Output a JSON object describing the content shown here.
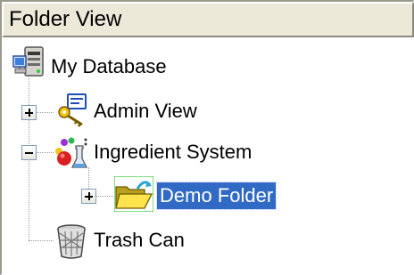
{
  "panel": {
    "title": "Folder View"
  },
  "tree": {
    "root": {
      "label": "My Database",
      "icon": "database-server-icon"
    },
    "nodes": [
      {
        "label": "Admin View",
        "icon": "admin-keys-icon",
        "state": "collapsed"
      },
      {
        "label": "Ingredient System",
        "icon": "molecule-flask-icon",
        "state": "expanded"
      },
      {
        "label": "Demo Folder",
        "icon": "open-folder-icon",
        "state": "collapsed",
        "selected": true
      },
      {
        "label": "Trash Can",
        "icon": "trash-can-icon"
      }
    ]
  },
  "colors": {
    "selection": "#316ac5",
    "panel_face": "#ece9d8"
  }
}
